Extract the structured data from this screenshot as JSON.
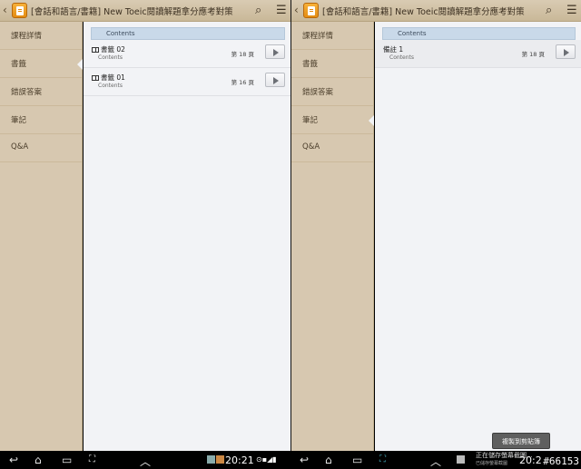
{
  "app": {
    "title": "[會話和語言/書籍] New Toeic閱讀解題拿分應考對策"
  },
  "sidebar": {
    "items": [
      {
        "label": "課程詳情"
      },
      {
        "label": "書籤"
      },
      {
        "label": "錯誤答案"
      },
      {
        "label": "筆記"
      },
      {
        "label": "Q&A"
      }
    ]
  },
  "left_panel": {
    "header": "Contents",
    "rows": [
      {
        "title": "書籤 02",
        "subtitle": "Contents",
        "page": "第 18 頁"
      },
      {
        "title": "書籤 01",
        "subtitle": "Contents",
        "page": "第 16 頁"
      }
    ]
  },
  "right_panel": {
    "header": "Contents",
    "rows": [
      {
        "title": "備註 1",
        "subtitle": "Contents",
        "page": "第 18 頁"
      }
    ],
    "toast": "複製到剪貼簿"
  },
  "status_bar": {
    "left_time": "20:21",
    "right_notice": "正在儲存螢幕截圖...",
    "right_notice_sub": "已儲存螢幕截圖",
    "right_time": "20:2"
  },
  "watermark": "#66153",
  "icons": {
    "back": "back-arrow-icon",
    "search": "search-icon",
    "menu": "menu-icon",
    "play": "play-icon"
  }
}
